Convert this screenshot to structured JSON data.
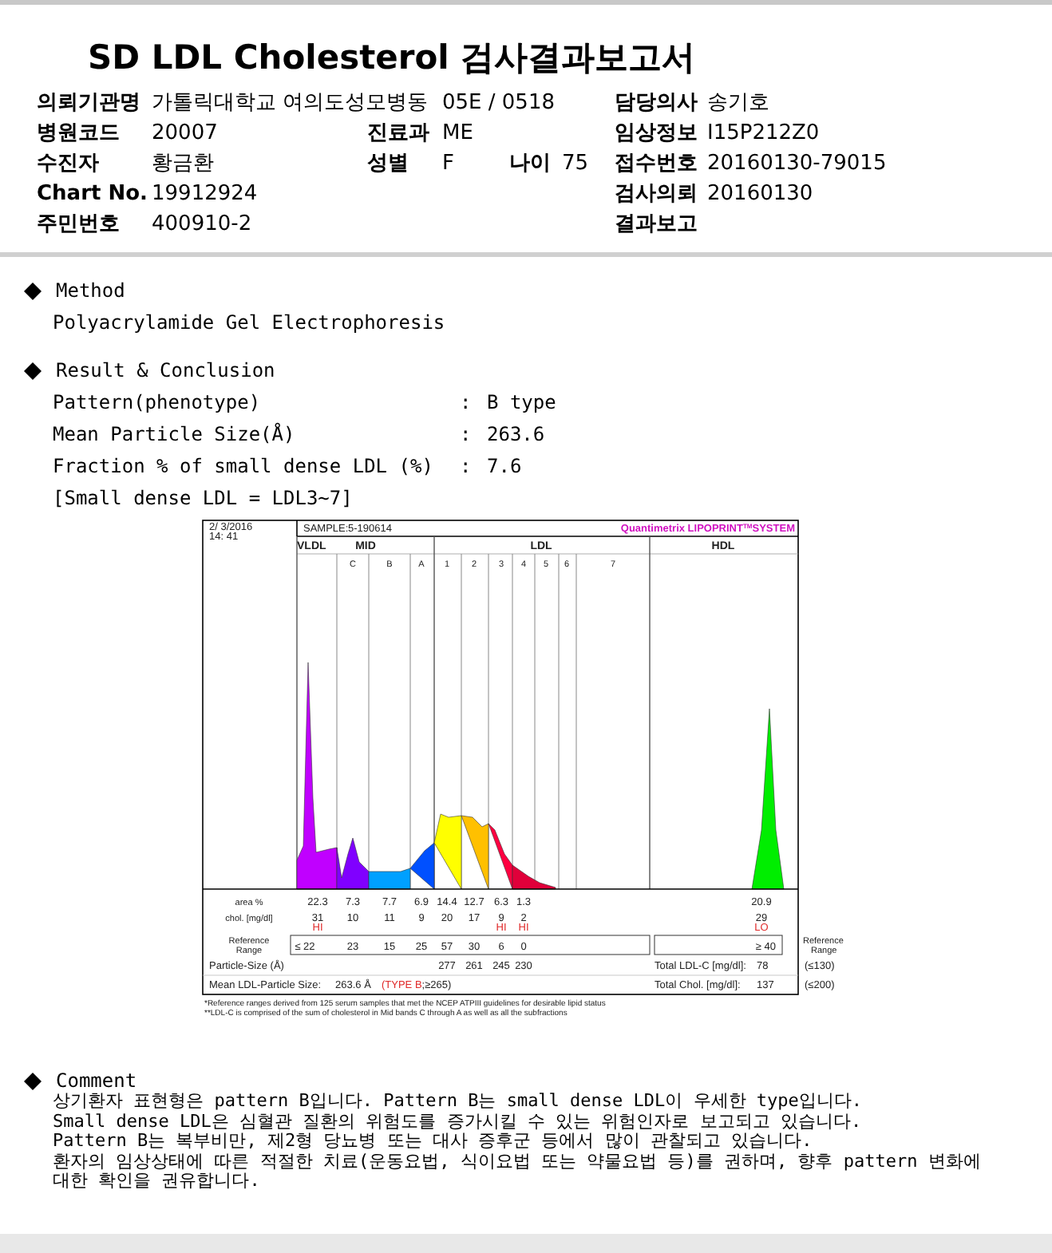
{
  "title": "SD LDL Cholesterol 검사결과보고서",
  "patient_info": [
    [
      {
        "kind": "left_label",
        "text": "의뢰기관명"
      },
      {
        "kind": "left_value",
        "text": "가톨릭대학교 여의도성모병동"
      },
      {
        "kind": "mid_value",
        "text": "05E / 0518"
      },
      {
        "kind": "right_label",
        "text": "담당의사"
      },
      {
        "kind": "right_value",
        "text": "송기호"
      }
    ],
    [
      {
        "kind": "left_label",
        "text": "병원코드"
      },
      {
        "kind": "left_value",
        "text": "20007"
      },
      {
        "kind": "mid_label",
        "text": "진료과"
      },
      {
        "kind": "mid_value",
        "text": "ME"
      },
      {
        "kind": "right_label",
        "text": "임상정보"
      },
      {
        "kind": "right_value",
        "text": "I15P212Z0"
      }
    ],
    [
      {
        "kind": "left_label",
        "text": "수진자"
      },
      {
        "kind": "left_value",
        "text": "황금환"
      },
      {
        "kind": "mid_label",
        "text": "성별"
      },
      {
        "kind": "mid_value",
        "text": "F"
      },
      {
        "kind": "age_label",
        "text": "나이"
      },
      {
        "kind": "age_value",
        "text": "75"
      },
      {
        "kind": "right_label",
        "text": "접수번호"
      },
      {
        "kind": "right_value",
        "text": "20160130-79015"
      }
    ],
    [
      {
        "kind": "left_label",
        "text": "Chart No."
      },
      {
        "kind": "left_value",
        "text": "19912924"
      },
      {
        "kind": "right_label",
        "text": "검사의뢰"
      },
      {
        "kind": "right_value",
        "text": "20160130"
      }
    ],
    [
      {
        "kind": "left_label",
        "text": "주민번호"
      },
      {
        "kind": "left_value",
        "text": "400910-2"
      },
      {
        "kind": "right_label",
        "text": "결과보고"
      }
    ]
  ],
  "method": {
    "heading": "Method",
    "text": "Polyacrylamide Gel Electrophoresis"
  },
  "result": {
    "heading": "Result & Conclusion",
    "items": [
      {
        "label": "Pattern(phenotype)",
        "separator": ":",
        "value": "B type"
      },
      {
        "label": "Mean Particle Size(Å)",
        "separator": ":",
        "value": "263.6"
      },
      {
        "label": "Fraction % of small dense LDL (%)",
        "separator": ":",
        "value": "7.6"
      }
    ],
    "note": "[Small dense LDL = LDL3~7]"
  },
  "report": {
    "date": "2/ 3/2016",
    "time": "14: 41",
    "sample_label": "SAMPLE:",
    "sample": "5-190614",
    "system_name": "Quantimetrix LIPOPRINT",
    "system_mark": "TM",
    "system_suffix": "SYSTEM",
    "bands": [
      "VLDL",
      "MID",
      "LDL",
      "HDL"
    ],
    "subbands": [
      "C",
      "B",
      "A",
      "1",
      "2",
      "3",
      "4",
      "5",
      "6",
      "7"
    ],
    "area_label": "area %",
    "areas": [
      "22.3",
      "7.3",
      "7.7",
      "6.9",
      "14.4",
      "12.7",
      "6.3",
      "1.3"
    ],
    "hdl_area": "20.9",
    "chol_label": "chol. [mg/dl]",
    "chol": [
      {
        "value": "31",
        "flag": "HI"
      },
      {
        "value": "10"
      },
      {
        "value": "11"
      },
      {
        "value": "9"
      },
      {
        "value": "20"
      },
      {
        "value": "17"
      },
      {
        "value": "9",
        "flag": "HI"
      },
      {
        "value": "2",
        "flag": "HI"
      }
    ],
    "hdl_chol": {
      "value": "29",
      "flag": "LO"
    },
    "ref_label": [
      "Reference",
      "Range"
    ],
    "ref_values": [
      "≤ 22",
      "23",
      "15",
      "25",
      "57",
      "30",
      "6",
      "0"
    ],
    "hdl_ref": "≥ 40",
    "ref_label_right": [
      "Reference",
      "Range"
    ],
    "particle_label": "Particle-Size (Å)",
    "particle_sizes": [
      "277",
      "261",
      "245",
      "230"
    ],
    "total_ldl_label": "Total LDL-C [mg/dl]:",
    "total_ldl": "78",
    "total_ldl_ref": "(≤130)",
    "mean_label": "Mean LDL-Particle Size:",
    "mean_value": "263.6 Å",
    "mean_type": "(TYPE B",
    "mean_ref": ";≥265)",
    "total_chol_label": "Total Chol. [mg/dl]:",
    "total_chol": "137",
    "total_chol_ref": "(≤200)",
    "footnotes": [
      "*Reference ranges derived from 125 serum samples that met the NCEP ATPIII guidelines for desirable lipid status",
      "**LDL-C is comprised of the sum of cholesterol in Mid bands C through A as well as all the subfractions"
    ]
  },
  "comment": {
    "heading": "Comment",
    "lines": [
      "상기환자 표현형은 pattern B입니다. Pattern B는 small dense LDL이 우세한 type입니다.",
      "Small dense LDL은 심혈관 질환의 위험도를 증가시킬 수 있는 위험인자로 보고되고 있습니다.",
      "Pattern B는 복부비만, 제2형 당뇨병 또는 대사 증후군 등에서 많이 관찰되고 있습니다.",
      "환자의 임상상태에 따른 적절한 치료(운동요법, 식이요법 또는 약물요법 등)를 권하며, 향후 pattern 변화에",
      "대한 확인을 권유합니다."
    ]
  }
}
